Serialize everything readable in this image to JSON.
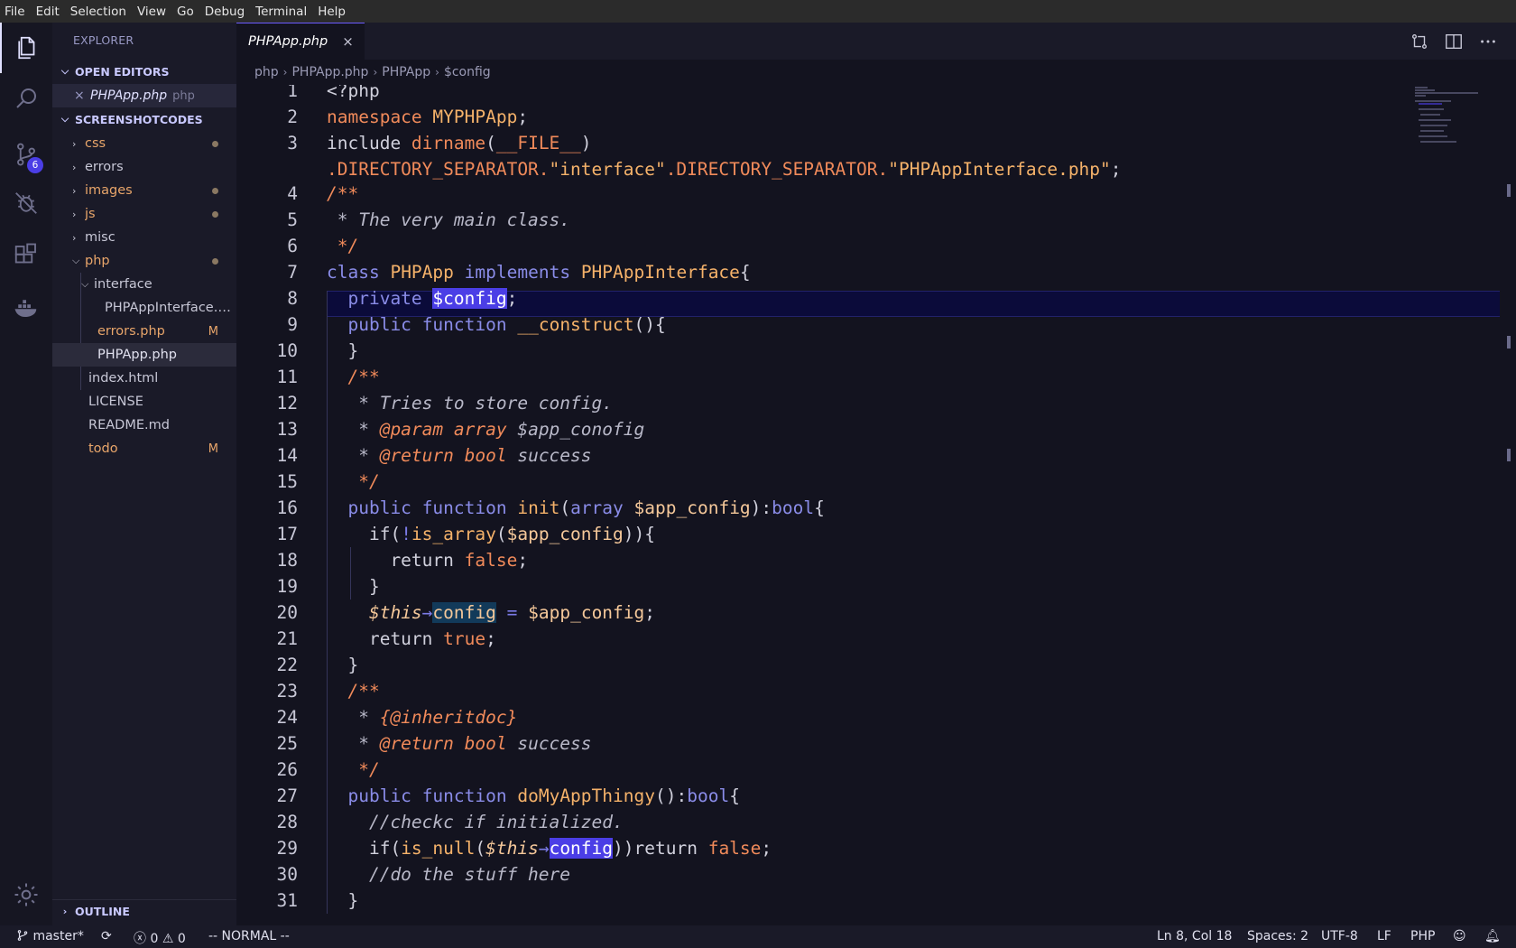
{
  "menu": [
    "File",
    "Edit",
    "Selection",
    "View",
    "Go",
    "Debug",
    "Terminal",
    "Help"
  ],
  "activity": {
    "scm_badge": "6"
  },
  "sidebar": {
    "title": "EXPLORER",
    "open_editors_label": "OPEN EDITORS",
    "open_editor": {
      "close": "×",
      "name": "PHPApp.php",
      "lang": "php"
    },
    "workspace_label": "SCREENSHOTCODES",
    "tree": [
      {
        "label": "css",
        "type": "folder",
        "marker": "dot"
      },
      {
        "label": "errors",
        "type": "folder",
        "marker": ""
      },
      {
        "label": "images",
        "type": "folder",
        "marker": "dot"
      },
      {
        "label": "js",
        "type": "folder",
        "marker": "dot"
      },
      {
        "label": "misc",
        "type": "folder",
        "marker": ""
      },
      {
        "label": "php",
        "type": "folder-open",
        "marker": "dot"
      },
      {
        "label": "interface",
        "type": "folder-open",
        "marker": ""
      },
      {
        "label": "PHPAppInterface.php",
        "type": "file",
        "marker": ""
      },
      {
        "label": "errors.php",
        "type": "file",
        "marker": "M"
      },
      {
        "label": "PHPApp.php",
        "type": "file",
        "marker": ""
      },
      {
        "label": "index.html",
        "type": "file",
        "marker": ""
      },
      {
        "label": "LICENSE",
        "type": "file",
        "marker": ""
      },
      {
        "label": "README.md",
        "type": "file",
        "marker": ""
      },
      {
        "label": "todo",
        "type": "file",
        "marker": "M"
      }
    ],
    "outline_label": "OUTLINE"
  },
  "tab": {
    "name": "PHPApp.php",
    "close": "×"
  },
  "breadcrumb": [
    "php",
    "PHPApp.php",
    "PHPApp",
    "$config"
  ],
  "line_numbers": [
    "1",
    "2",
    "3",
    "4",
    "5",
    "6",
    "7",
    "8",
    "9",
    "10",
    "11",
    "12",
    "13",
    "14",
    "15",
    "16",
    "17",
    "18",
    "19",
    "20",
    "21",
    "22",
    "23",
    "24",
    "25",
    "26",
    "27",
    "28",
    "29",
    "30",
    "31"
  ],
  "status": {
    "branch": "master*",
    "errors": "0",
    "warnings": "0",
    "mode": "-- NORMAL --",
    "position": "Ln 8, Col 18",
    "spaces": "Spaces: 2",
    "encoding": "UTF-8",
    "eol": "LF",
    "language": "PHP"
  },
  "colors": {
    "accent": "#4b3ee6",
    "modified": "#e8a56a",
    "background": "#13131f"
  }
}
